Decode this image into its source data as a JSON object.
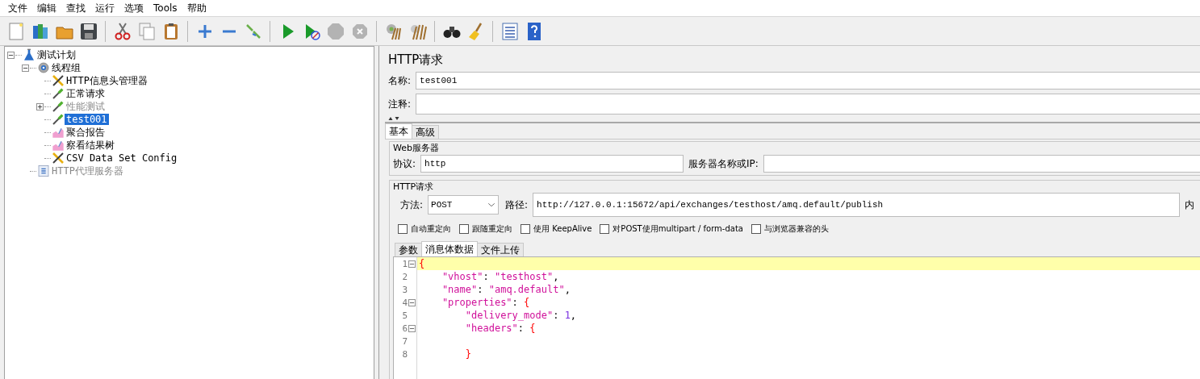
{
  "menu": [
    "文件",
    "编辑",
    "查找",
    "运行",
    "选项",
    "Tools",
    "帮助"
  ],
  "toolbar": [
    {
      "kind": "new",
      "disabled": false
    },
    {
      "kind": "templates",
      "disabled": false
    },
    {
      "kind": "open",
      "disabled": false
    },
    {
      "kind": "save",
      "disabled": false
    },
    {
      "kind": "separator"
    },
    {
      "kind": "cut",
      "disabled": false
    },
    {
      "kind": "copy",
      "disabled": false
    },
    {
      "kind": "paste",
      "disabled": false
    },
    {
      "kind": "separator"
    },
    {
      "kind": "expand",
      "disabled": false
    },
    {
      "kind": "collapse",
      "disabled": false
    },
    {
      "kind": "toggle",
      "disabled": false
    },
    {
      "kind": "separator"
    },
    {
      "kind": "start",
      "disabled": false
    },
    {
      "kind": "start-no-pauses",
      "disabled": false
    },
    {
      "kind": "stop",
      "disabled": true
    },
    {
      "kind": "shutdown",
      "disabled": true
    },
    {
      "kind": "separator"
    },
    {
      "kind": "clear",
      "disabled": false
    },
    {
      "kind": "clear-all",
      "disabled": false
    },
    {
      "kind": "separator"
    },
    {
      "kind": "search",
      "disabled": false
    },
    {
      "kind": "reset-search",
      "disabled": false
    },
    {
      "kind": "separator"
    },
    {
      "kind": "function-helper",
      "disabled": false
    },
    {
      "kind": "help",
      "disabled": false
    }
  ],
  "tree": {
    "items": [
      {
        "label": "测试计划",
        "kind": "plan",
        "expanded": true,
        "selected": false,
        "disabled": false,
        "children": [
          {
            "label": "线程组",
            "kind": "thread-group",
            "expanded": true,
            "selected": false,
            "disabled": false,
            "children": [
              {
                "label": "HTTP信息头管理器",
                "kind": "config",
                "selected": false,
                "disabled": false
              },
              {
                "label": "正常请求",
                "kind": "sampler",
                "selected": false,
                "disabled": false
              },
              {
                "label": "性能测试",
                "kind": "sampler",
                "expanded": false,
                "selected": false,
                "disabled": true
              },
              {
                "label": "test001",
                "kind": "sampler",
                "selected": true,
                "disabled": false
              },
              {
                "label": "聚合报告",
                "kind": "listener",
                "selected": false,
                "disabled": false
              },
              {
                "label": "察看结果树",
                "kind": "listener",
                "selected": false,
                "disabled": false
              },
              {
                "label": "CSV Data Set Config",
                "kind": "config",
                "selected": false,
                "disabled": false
              }
            ]
          },
          {
            "label": "HTTP代理服务器",
            "kind": "proxy",
            "selected": false,
            "disabled": true
          }
        ]
      }
    ]
  },
  "panel": {
    "title": "HTTP请求",
    "name_label": "名称:",
    "name_value": "test001",
    "comment_label": "注释:",
    "tabs": [
      {
        "label": "基本",
        "selected": true
      },
      {
        "label": "高级",
        "selected": false
      }
    ],
    "web_server": {
      "legend": "Web服务器",
      "protocol_label": "协议:",
      "protocol_value": "http",
      "server_label": "服务器名称或IP:"
    },
    "http_request": {
      "legend": "HTTP请求",
      "method_label": "方法:",
      "method_value": "POST",
      "path_label": "路径:",
      "path_value": "http://127.0.0.1:15672/api/exchanges/testhost/amq.default/publish",
      "encoding_label": "内",
      "options": [
        {
          "label": "自动重定向",
          "checked": false
        },
        {
          "label": "跟随重定向",
          "checked": false
        },
        {
          "label": "使用 KeepAlive",
          "checked": false
        },
        {
          "label": "对POST使用multipart / form-data",
          "checked": false
        },
        {
          "label": "与浏览器兼容的头",
          "checked": false
        }
      ]
    },
    "body_tabs": [
      {
        "label": "参数",
        "selected": false
      },
      {
        "label": "消息体数据",
        "selected": true
      },
      {
        "label": "文件上传",
        "selected": false
      }
    ],
    "editor": {
      "lines": [
        {
          "number": "1",
          "fold": true,
          "highlighted": true,
          "tokens": [
            {
              "kind": "brace",
              "text": "{"
            }
          ]
        },
        {
          "number": "2",
          "fold": false,
          "highlighted": false,
          "tokens": [
            {
              "kind": "string",
              "text": "    \"vhost\""
            },
            {
              "kind": "punct",
              "text": ": "
            },
            {
              "kind": "string",
              "text": "\"testhost\""
            },
            {
              "kind": "punct",
              "text": ","
            }
          ]
        },
        {
          "number": "3",
          "fold": false,
          "highlighted": false,
          "tokens": [
            {
              "kind": "string",
              "text": "    \"name\""
            },
            {
              "kind": "punct",
              "text": ": "
            },
            {
              "kind": "string",
              "text": "\"amq.default\""
            },
            {
              "kind": "punct",
              "text": ","
            }
          ]
        },
        {
          "number": "4",
          "fold": true,
          "highlighted": false,
          "tokens": [
            {
              "kind": "string",
              "text": "    \"properties\""
            },
            {
              "kind": "punct",
              "text": ": "
            },
            {
              "kind": "brace",
              "text": "{"
            }
          ]
        },
        {
          "number": "5",
          "fold": false,
          "highlighted": false,
          "tokens": [
            {
              "kind": "string",
              "text": "        \"delivery_mode\""
            },
            {
              "kind": "punct",
              "text": ": "
            },
            {
              "kind": "number",
              "text": "1"
            },
            {
              "kind": "punct",
              "text": ","
            }
          ]
        },
        {
          "number": "6",
          "fold": true,
          "highlighted": false,
          "tokens": [
            {
              "kind": "string",
              "text": "        \"headers\""
            },
            {
              "kind": "punct",
              "text": ": "
            },
            {
              "kind": "brace",
              "text": "{"
            }
          ]
        },
        {
          "number": "7",
          "fold": false,
          "highlighted": false
        },
        {
          "number": "8",
          "fold": false,
          "highlighted": false,
          "tokens": [
            {
              "kind": "brace",
              "text": "        }"
            }
          ]
        }
      ]
    }
  }
}
